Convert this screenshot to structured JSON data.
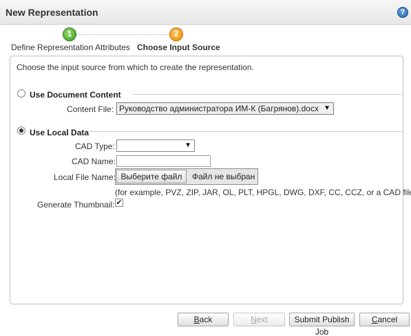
{
  "window": {
    "title": "New Representation",
    "help_icon": "question-circle-icon",
    "help_glyph": "?"
  },
  "wizard": {
    "steps": [
      {
        "number": "1",
        "label": "Define Representation Attributes",
        "status": "completed",
        "color": "#4caf2a"
      },
      {
        "number": "2",
        "label": "Choose Input Source",
        "status": "current",
        "color": "#f39200"
      }
    ]
  },
  "content": {
    "instruction": "Choose the input source from which to create the representation.",
    "document_section": {
      "title": "Use Document Content",
      "selected": false,
      "content_file_label": "Content File:",
      "content_file_value": "Руководство администратора ИМ-К (Багрянов).docx"
    },
    "local_section": {
      "title": "Use Local Data",
      "selected": true,
      "cad_type_label": "CAD Type:",
      "cad_type_value": "",
      "cad_name_label": "CAD Name:",
      "cad_name_value": "",
      "local_file_label": "Local File Name:",
      "file_button_label": "Выберите файл",
      "file_status": "Файл не выбран",
      "file_hint": "(for example, PVZ, ZIP, JAR, OL, PLT, HPGL, DWG, DXF, CC, CCZ, or a CAD file)",
      "thumbnail_label": "Generate Thumbnail:",
      "thumbnail_checked": true
    }
  },
  "footer": {
    "back_label": "Back",
    "next_label": "Next",
    "submit_label": "Submit Publish Job",
    "cancel_label": "Cancel"
  }
}
